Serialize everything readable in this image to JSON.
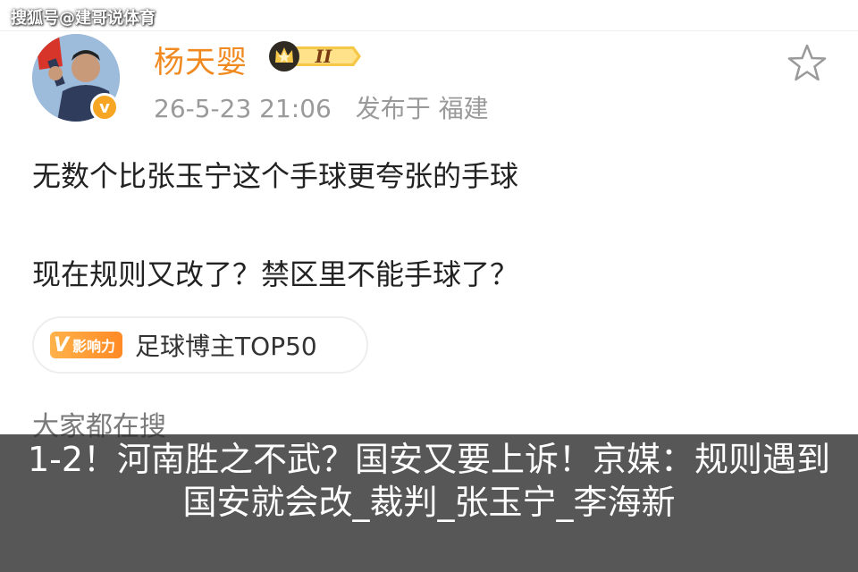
{
  "watermark": "搜狐号@建哥说体育",
  "post": {
    "author": "杨天婴",
    "vip_level": "II",
    "timestamp": "26-5-23 21:06",
    "location": "发布于 福建",
    "lines": [
      "无数个比张玉宁这个手球更夸张的手球",
      "现在规则又改了？禁区里不能手球了？"
    ]
  },
  "influence": {
    "badge_text": "影响力",
    "label": "足球博主TOP50"
  },
  "section_heading": "大家都在搜",
  "caption": "1-2！河南胜之不武？国安又要上诉！京媒：规则遇到国安就会改_裁判_张玉宁_李海新",
  "colors": {
    "username": "#f08a20",
    "caption_bg": "#282828",
    "badge_orange": "#f6a623"
  },
  "icons": [
    "avatar",
    "verified-icon",
    "vip-crown-icon",
    "star-icon"
  ]
}
